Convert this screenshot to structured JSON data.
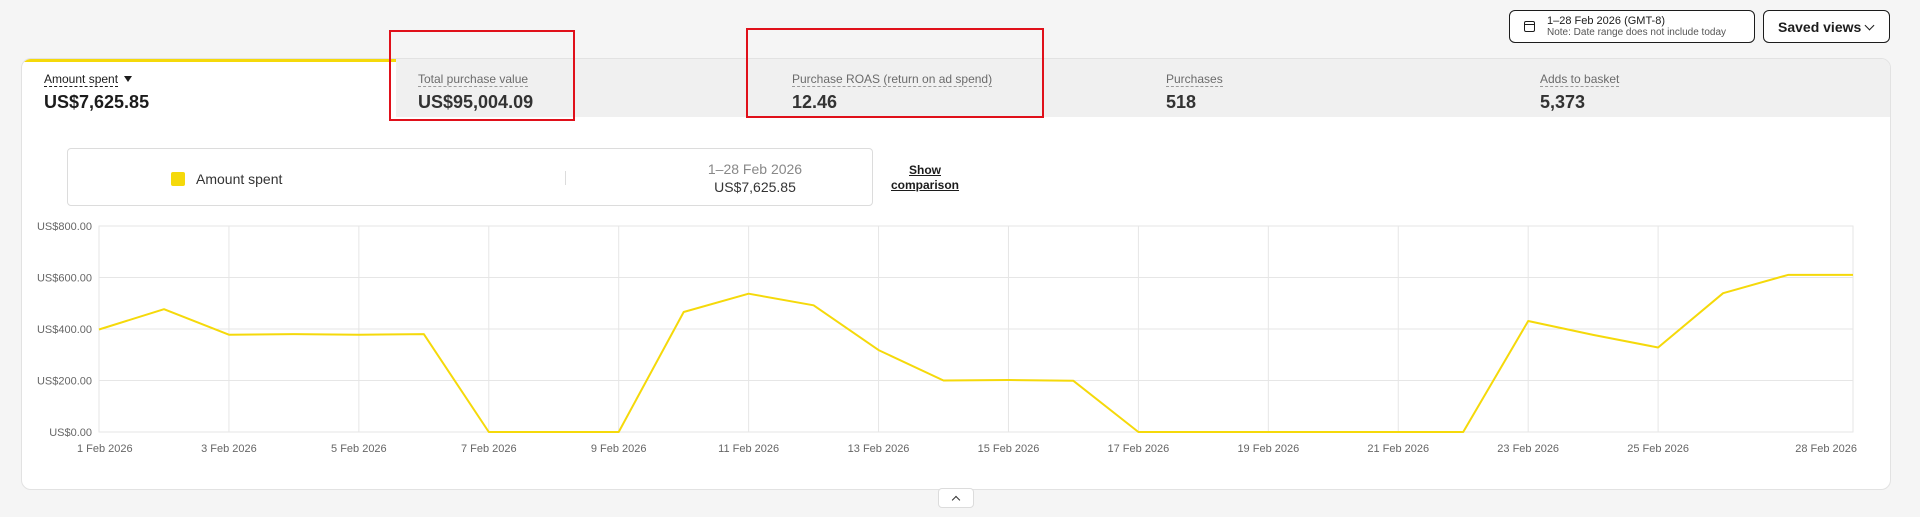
{
  "header": {
    "date_range": "1–28 Feb 2026 (GMT-8)",
    "date_note": "Note: Date range does not include today",
    "saved_views_label": "Saved views"
  },
  "metrics": [
    {
      "label": "Amount spent",
      "value": "US$7,625.85",
      "active": true
    },
    {
      "label": "Total purchase value",
      "value": "US$95,004.09",
      "active": false
    },
    {
      "label": "Purchase ROAS (return on ad spend)",
      "value": "12.46",
      "active": false
    },
    {
      "label": "Purchases",
      "value": "518",
      "active": false
    },
    {
      "label": "Adds to basket",
      "value": "5,373",
      "active": false
    }
  ],
  "legend": {
    "series_name": "Amount spent",
    "period": "1–28 Feb 2026",
    "total": "US$7,625.85",
    "show_comparison_line1": "Show",
    "show_comparison_line2": "comparison"
  },
  "colors": {
    "accent": "#f5d90a",
    "highlight_box": "#e0101a",
    "grid": "#e6e6e6"
  },
  "chart_data": {
    "type": "line",
    "x": [
      "1 Feb 2026",
      "2 Feb 2026",
      "3 Feb 2026",
      "4 Feb 2026",
      "5 Feb 2026",
      "6 Feb 2026",
      "7 Feb 2026",
      "8 Feb 2026",
      "9 Feb 2026",
      "10 Feb 2026",
      "11 Feb 2026",
      "12 Feb 2026",
      "13 Feb 2026",
      "14 Feb 2026",
      "15 Feb 2026",
      "16 Feb 2026",
      "17 Feb 2026",
      "18 Feb 2026",
      "19 Feb 2026",
      "20 Feb 2026",
      "21 Feb 2026",
      "22 Feb 2026",
      "23 Feb 2026",
      "24 Feb 2026",
      "25 Feb 2026",
      "26 Feb 2026",
      "27 Feb 2026",
      "28 Feb 2026"
    ],
    "series": [
      {
        "name": "Amount spent",
        "values": [
          398,
          477,
          378,
          380,
          378,
          380,
          0,
          0,
          0,
          466,
          537,
          492,
          318,
          200,
          202,
          199,
          0,
          0,
          0,
          0,
          0,
          0,
          431,
          377,
          328,
          539,
          610,
          610
        ]
      }
    ],
    "xtick_labels": [
      "1 Feb 2026",
      "3 Feb 2026",
      "5 Feb 2026",
      "7 Feb 2026",
      "9 Feb 2026",
      "11 Feb 2026",
      "13 Feb 2026",
      "15 Feb 2026",
      "17 Feb 2026",
      "19 Feb 2026",
      "21 Feb 2026",
      "23 Feb 2026",
      "25 Feb 2026",
      "28 Feb 2026"
    ],
    "yticks": [
      0,
      200,
      400,
      600,
      800
    ],
    "ytick_labels": [
      "US$0.00",
      "US$200.00",
      "US$400.00",
      "US$600.00",
      "US$800.00"
    ],
    "ylim": [
      0,
      800
    ],
    "grid": true,
    "legend_position": "top-left"
  }
}
